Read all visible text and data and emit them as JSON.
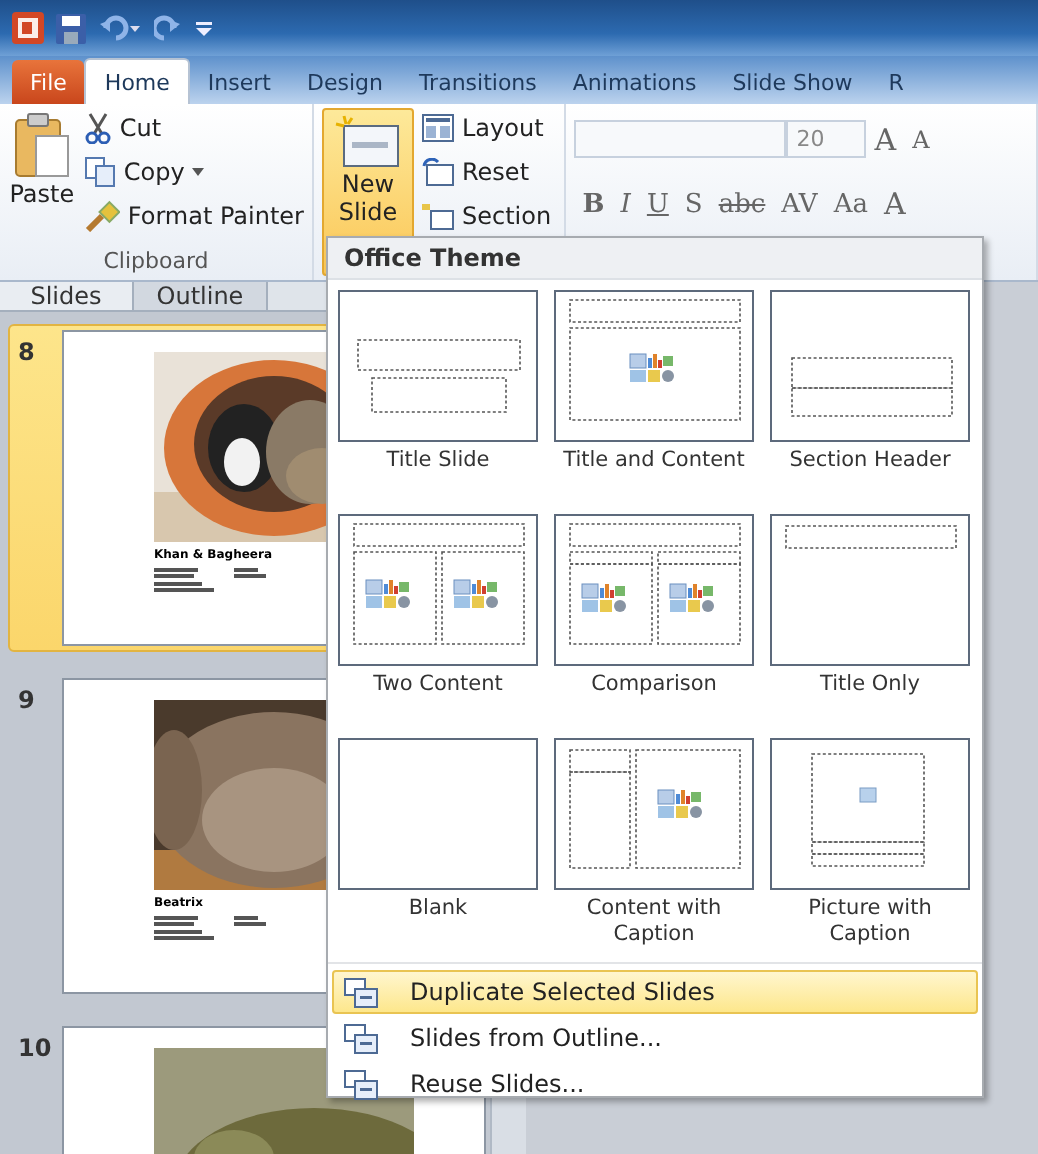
{
  "ribbon_tabs": [
    {
      "label": "File",
      "kind": "file",
      "selected": false
    },
    {
      "label": "Home",
      "kind": "tab",
      "selected": true
    },
    {
      "label": "Insert",
      "kind": "tab",
      "selected": false
    },
    {
      "label": "Design",
      "kind": "tab",
      "selected": false
    },
    {
      "label": "Transitions",
      "kind": "tab",
      "selected": false
    },
    {
      "label": "Animations",
      "kind": "tab",
      "selected": false
    },
    {
      "label": "Slide Show",
      "kind": "tab",
      "selected": false
    },
    {
      "label": "R",
      "kind": "tab",
      "selected": false
    }
  ],
  "clipboard": {
    "paste": "Paste",
    "cut": "Cut",
    "copy": "Copy",
    "format_painter": "Format Painter",
    "group_label": "Clipboard"
  },
  "slides_group": {
    "new_slide": "New Slide",
    "new_slide_pressed": true,
    "layout": "Layout",
    "reset": "Reset",
    "section": "Section"
  },
  "font_group": {
    "font_size": "20",
    "size_buttons": [
      "A",
      "A"
    ],
    "format_buttons": [
      "B",
      "I",
      "U",
      "S",
      "abc",
      "AV",
      "Aa"
    ],
    "color_button": "A"
  },
  "pane_tabs": [
    {
      "label": "Slides",
      "selected": true
    },
    {
      "label": "Outline",
      "selected": false
    }
  ],
  "slides": [
    {
      "number": "8",
      "selected": true,
      "title": "Khan & Bagheera"
    },
    {
      "number": "9",
      "selected": false,
      "title": "Beatrix"
    },
    {
      "number": "10",
      "selected": false
    }
  ],
  "layout_menu": {
    "title": "Office Theme",
    "layouts": [
      {
        "label": "Title Slide",
        "kind": "title"
      },
      {
        "label": "Title and Content",
        "kind": "title-content"
      },
      {
        "label": "Section Header",
        "kind": "section"
      },
      {
        "label": "Two Content",
        "kind": "two-content"
      },
      {
        "label": "Comparison",
        "kind": "comparison"
      },
      {
        "label": "Title Only",
        "kind": "title-only"
      },
      {
        "label": "Blank",
        "kind": "blank"
      },
      {
        "label": "Content with Caption",
        "kind": "content-caption"
      },
      {
        "label": "Picture with Caption",
        "kind": "picture-caption"
      }
    ],
    "items": [
      {
        "label": "Duplicate Selected Slides",
        "selected": true
      },
      {
        "label": "Slides from Outline...",
        "selected": false
      },
      {
        "label": "Reuse Slides...",
        "selected": false
      }
    ]
  }
}
